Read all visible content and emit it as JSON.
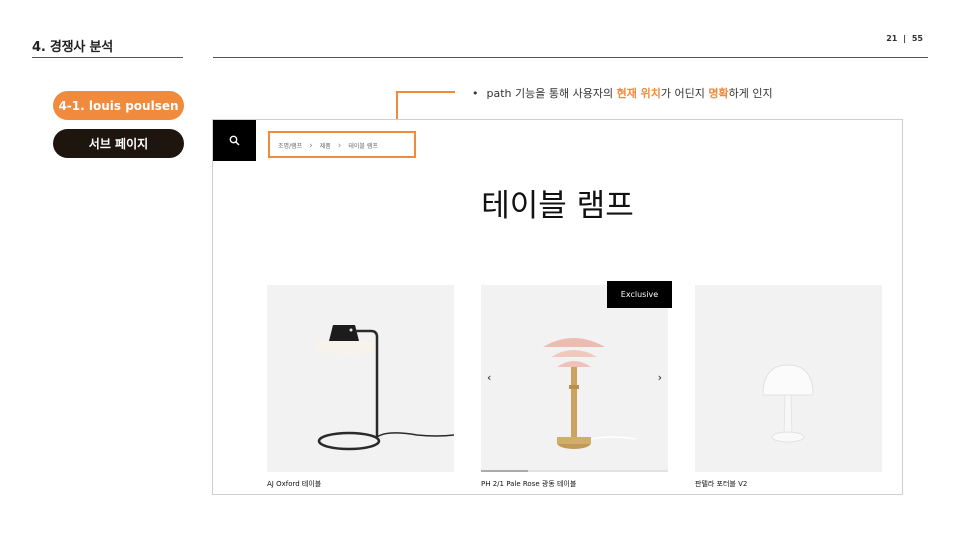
{
  "slide": {
    "title": "4. 경쟁사 분석",
    "page_current": "21",
    "page_separator": "|",
    "page_total": "55"
  },
  "pills": {
    "brand": "4-1. louis poulsen",
    "page": "서브 페이지"
  },
  "annotation": {
    "bullet": "•",
    "part1": "path 기능을 통해 사용자의 ",
    "highlight1": "현재 위치",
    "part2": "가 어딘지 ",
    "highlight2": "명확",
    "part3": "하게 인지"
  },
  "site": {
    "search_icon": "search-icon",
    "breadcrumb": [
      "조명/램프",
      "제품",
      "테이블 램프"
    ],
    "heading": "테이블 램프",
    "products": [
      {
        "name": "AJ Oxford 테이블"
      },
      {
        "name": "PH 2/1 Pale Rose 광동 테이블",
        "badge": "Exclusive",
        "progress": 0.25
      },
      {
        "name": "판텔라 포터블 V2"
      }
    ]
  },
  "colors": {
    "accent": "#f08a3c",
    "dark_pill": "#1f150f"
  }
}
